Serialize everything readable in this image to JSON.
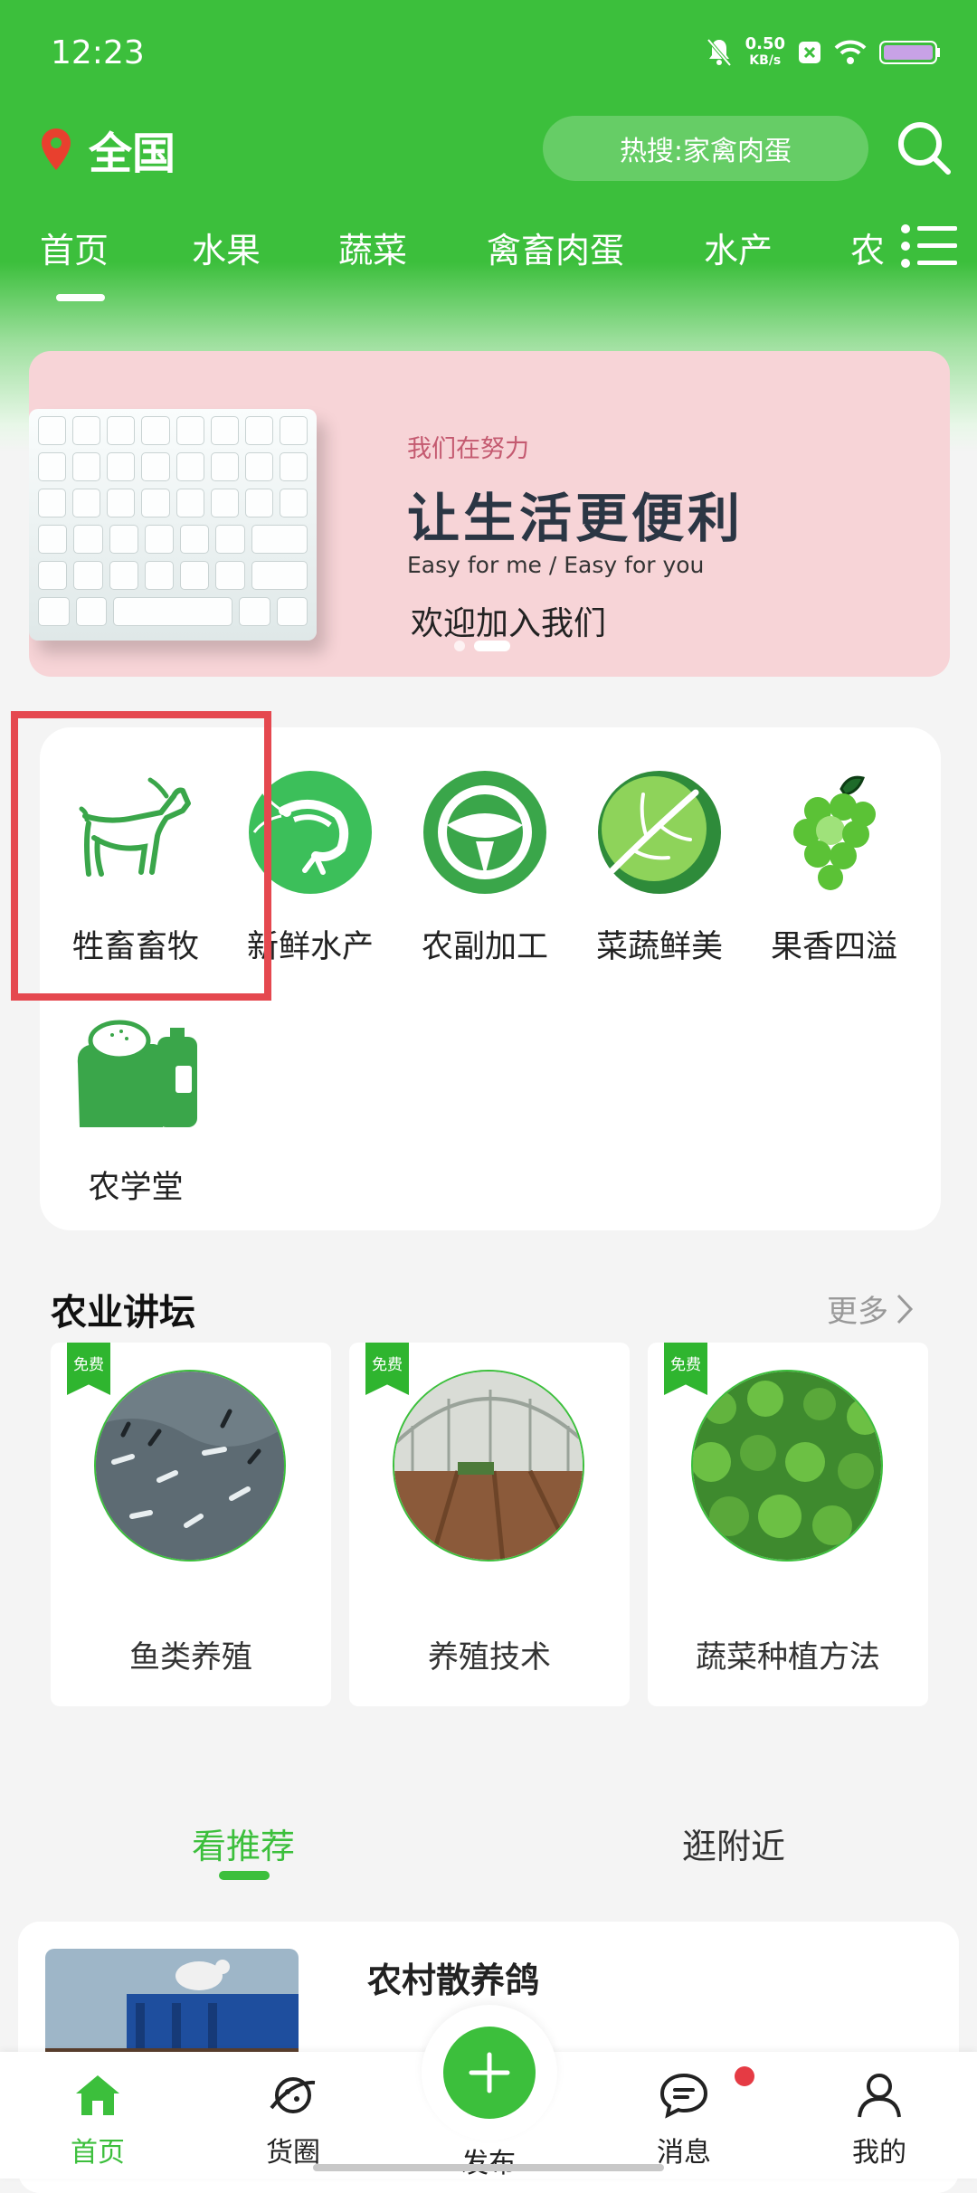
{
  "status_bar": {
    "time": "12:23",
    "net_speed": "0.50",
    "net_unit": "KB/s"
  },
  "header": {
    "location": "全国",
    "hot_search": "热搜:家禽肉蛋"
  },
  "tabs": [
    "首页",
    "水果",
    "蔬菜",
    "禽畜肉蛋",
    "水产",
    "农"
  ],
  "banner": {
    "subtitle": "我们在努力",
    "title": "让生活更便利",
    "english": "Easy for me / Easy for you",
    "cta": "欢迎加入我们"
  },
  "categories": [
    {
      "label": "牲畜畜牧",
      "icon": "goat-icon"
    },
    {
      "label": "新鲜水产",
      "icon": "shrimp-icon"
    },
    {
      "label": "农副加工",
      "icon": "green-food-logo-icon"
    },
    {
      "label": "菜蔬鲜美",
      "icon": "cabbage-icon"
    },
    {
      "label": "果香四溢",
      "icon": "grapes-icon"
    },
    {
      "label": "农学堂",
      "icon": "fertilizer-bag-icon"
    }
  ],
  "forum": {
    "title": "农业讲坛",
    "more": "更多",
    "items": [
      {
        "tag": "免费",
        "label": "鱼类养殖"
      },
      {
        "tag": "免费",
        "label": "养殖技术"
      },
      {
        "tag": "免费",
        "label": "蔬菜种植方法"
      }
    ]
  },
  "rec_tabs": {
    "recommend": "看推荐",
    "nearby": "逛附近"
  },
  "post": {
    "title": "农村散养鸽"
  },
  "bottom_nav": [
    "首页",
    "货圈",
    "发布",
    "消息",
    "我的"
  ],
  "colors": {
    "brand_green": "#3cbf3c",
    "highlight_red": "#e5484f",
    "badge_red": "#e53b44"
  }
}
